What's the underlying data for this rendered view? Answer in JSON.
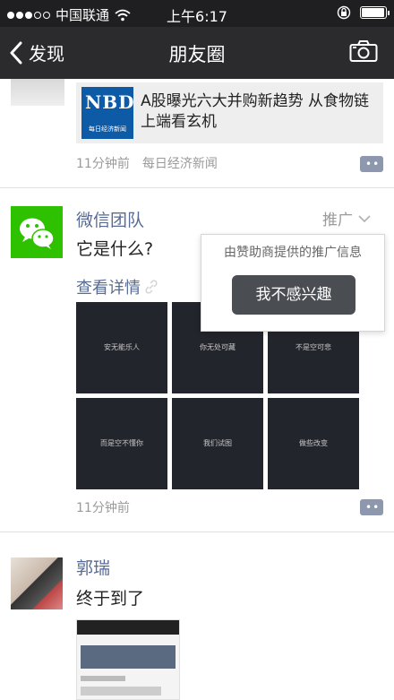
{
  "status_bar": {
    "carrier": "中国联通",
    "time": "上午6:17",
    "signal_dots_filled": 3,
    "signal_dots_total": 5,
    "battery_level": 0.9
  },
  "nav_bar": {
    "back_label": "发现",
    "title": "朋友圈",
    "camera_icon": "camera-icon"
  },
  "posts": [
    {
      "share_card": {
        "logo_text": "NBD",
        "logo_sub": "每日经济新闻",
        "title": "A股曝光六大并购新趋势 从食物链上端看玄机"
      },
      "time": "11分钟前",
      "source": "每日经济新闻"
    },
    {
      "author": "微信团队",
      "promo_label": "推广",
      "text": "它是什么?",
      "detail_link": "查看详情",
      "grid_tiles": [
        "安无能乐人",
        "你无处可藏",
        "不是空可悲",
        "而是空不懂你",
        "我们试图",
        "做些改变"
      ],
      "time": "11分钟前",
      "popover": {
        "info": "由赞助商提供的推广信息",
        "button": "我不感兴趣"
      }
    },
    {
      "author": "郭瑞",
      "text": "终于到了"
    }
  ],
  "colors": {
    "nav_bg": "#2b2b2d",
    "status_bg": "#1f1f21",
    "link_blue": "#576b95",
    "wechat_green": "#2dc100",
    "meta_gray": "#9a9a9a"
  }
}
